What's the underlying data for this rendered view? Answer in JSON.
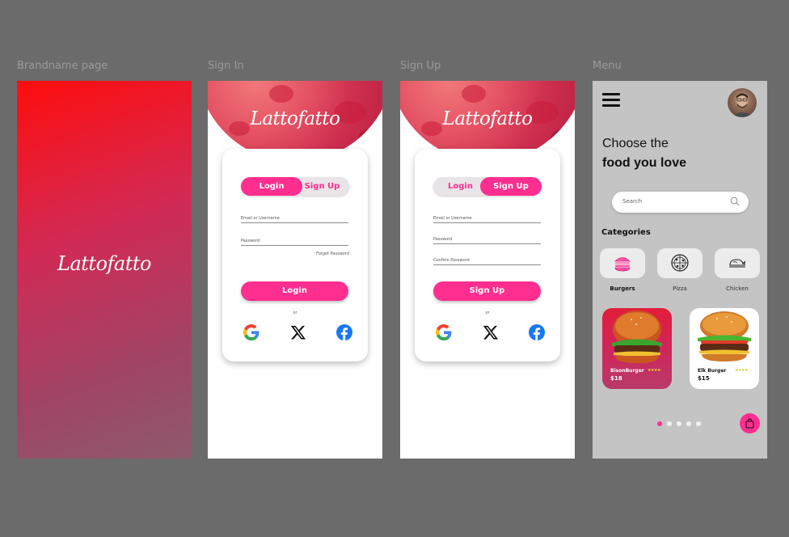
{
  "labels": {
    "brand_page": "Brandname page",
    "sign_in": "Sign In",
    "sign_up": "Sign Up",
    "menu": "Menu"
  },
  "brand": {
    "name": "Lattofatto"
  },
  "signin": {
    "tab_login": "Login",
    "tab_signup": "Sign Up",
    "email_placeholder": "Email or Username",
    "password_placeholder": "Password",
    "forgot": "Forgot Password",
    "button": "Login",
    "or": "or",
    "active_tab": "Login"
  },
  "signup": {
    "tab_login": "Login",
    "tab_signup": "Sign Up",
    "email_placeholder": "Email or Username",
    "password_placeholder": "Password",
    "confirm_placeholder": "Confirm Password",
    "button": "Sign Up",
    "or": "or",
    "active_tab": "Sign Up"
  },
  "social": [
    "google-icon",
    "x-icon",
    "facebook-icon"
  ],
  "menu": {
    "headline_1": "Choose the",
    "headline_2": "food you love",
    "search_placeholder": "Search",
    "categories_title": "Categories",
    "categories": [
      {
        "label": "Burgers",
        "icon": "burger-icon",
        "selected": true
      },
      {
        "label": "Pizza",
        "icon": "pizza-icon",
        "selected": false
      },
      {
        "label": "Chicken",
        "icon": "chicken-icon",
        "selected": false
      }
    ],
    "items": [
      {
        "name": "BisonBurger",
        "stars": "★★★★",
        "price": "$18"
      },
      {
        "name": "Elk Burger",
        "stars": "★★★★",
        "price": "$15"
      }
    ],
    "pagination": {
      "total": 5,
      "current": 1
    }
  },
  "colors": {
    "accent": "#ff2e8f",
    "brand_gradient_top": "#ff0d0d",
    "brand_gradient_bottom": "#8d5a6c",
    "menu_bg": "#c4c4c4"
  }
}
